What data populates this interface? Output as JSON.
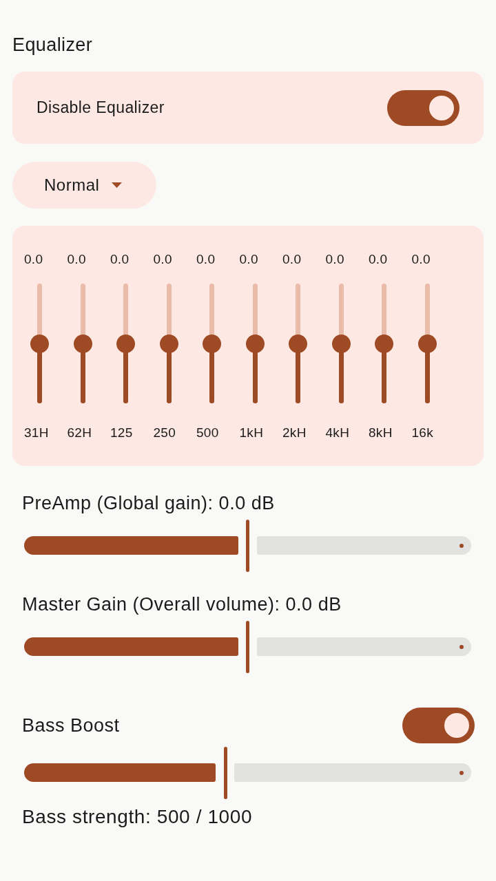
{
  "title": "Equalizer",
  "equalizer_toggle": {
    "label": "Disable Equalizer",
    "on": true
  },
  "preset_dropdown": {
    "value": "Normal"
  },
  "bands": [
    {
      "value": "0.0",
      "label": "31H",
      "level": 0.5
    },
    {
      "value": "0.0",
      "label": "62H",
      "level": 0.5
    },
    {
      "value": "0.0",
      "label": "125",
      "level": 0.5
    },
    {
      "value": "0.0",
      "label": "250",
      "level": 0.5
    },
    {
      "value": "0.0",
      "label": "500",
      "level": 0.5
    },
    {
      "value": "0.0",
      "label": "1kH",
      "level": 0.5
    },
    {
      "value": "0.0",
      "label": "2kH",
      "level": 0.5
    },
    {
      "value": "0.0",
      "label": "4kH",
      "level": 0.5
    },
    {
      "value": "0.0",
      "label": "8kH",
      "level": 0.5
    },
    {
      "value": "0.0",
      "label": "16k",
      "level": 0.5
    }
  ],
  "gain_sliders": [
    {
      "label": "PreAmp (Global gain): 0.0 dB",
      "level": 0.5
    },
    {
      "label": "Master Gain (Overall volume): 0.0 dB",
      "level": 0.5
    }
  ],
  "bass_boost": {
    "label": "Bass Boost",
    "on": true,
    "level": 0.45,
    "reading": "Bass strength: 500 / 1000"
  }
}
